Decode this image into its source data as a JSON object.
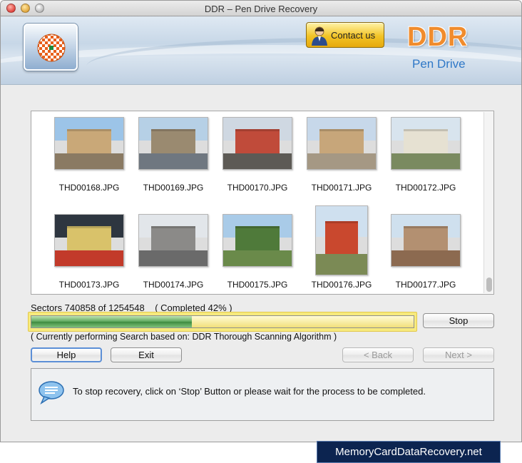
{
  "window": {
    "title": "DDR – Pen Drive Recovery"
  },
  "header": {
    "contact_label": "Contact us",
    "brand": "DDR",
    "brand_sub": "Pen Drive",
    "colors": {
      "brand": "#f08c2d",
      "brand_sub": "#2f78c7",
      "contact_button": "#f2c326"
    }
  },
  "gallery": {
    "files": [
      "THD00168.JPG",
      "THD00169.JPG",
      "THD00170.JPG",
      "THD00171.JPG",
      "THD00172.JPG",
      "THD00173.JPG",
      "THD00174.JPG",
      "THD00175.JPG",
      "THD00176.JPG",
      "THD00177.JPG"
    ]
  },
  "progress": {
    "sectors_text": "Sectors 740858 of 1254548",
    "completed_text": "( Completed 42% )",
    "percent": 42,
    "algorithm_text": "( Currently performing Search based on: DDR Thorough Scanning Algorithm )"
  },
  "buttons": {
    "stop": "Stop",
    "help": "Help",
    "exit": "Exit",
    "back": "< Back",
    "next": "Next >"
  },
  "info": {
    "message": "To stop recovery, click on ‘Stop’ Button or please wait for the process to be completed."
  },
  "footer": {
    "link_text": "MemoryCardDataRecovery.net"
  }
}
